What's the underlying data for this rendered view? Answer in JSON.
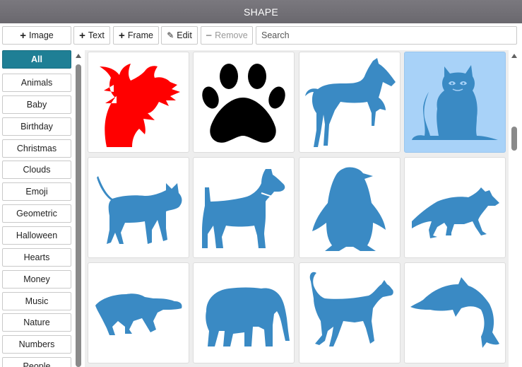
{
  "window": {
    "title": "SHAPE"
  },
  "toolbar": {
    "image": {
      "icon": "+",
      "label": "Image"
    },
    "text": {
      "icon": "+",
      "label": "Text"
    },
    "frame": {
      "icon": "+",
      "label": "Frame"
    },
    "edit": {
      "icon": "✎",
      "label": "Edit"
    },
    "remove": {
      "icon": "−",
      "label": "Remove"
    },
    "search": {
      "placeholder": "Search",
      "value": ""
    }
  },
  "sidebar": {
    "active": "All",
    "items": [
      {
        "label": "All"
      },
      {
        "label": "Animals"
      },
      {
        "label": "Baby"
      },
      {
        "label": "Birthday"
      },
      {
        "label": "Christmas"
      },
      {
        "label": "Clouds"
      },
      {
        "label": "Emoji"
      },
      {
        "label": "Geometric"
      },
      {
        "label": "Halloween"
      },
      {
        "label": "Hearts"
      },
      {
        "label": "Money"
      },
      {
        "label": "Music"
      },
      {
        "label": "Nature"
      },
      {
        "label": "Numbers"
      },
      {
        "label": "People"
      }
    ]
  },
  "grid": {
    "selected_index": 3,
    "shapes": [
      {
        "name": "dragon",
        "color": "#ff0000"
      },
      {
        "name": "paw",
        "color": "#000000"
      },
      {
        "name": "horse",
        "color": "#3a8ac4"
      },
      {
        "name": "cat-sitting",
        "color": "#3a8ac4"
      },
      {
        "name": "cat-walking",
        "color": "#3a8ac4"
      },
      {
        "name": "dog",
        "color": "#3a8ac4"
      },
      {
        "name": "penguin",
        "color": "#3a8ac4"
      },
      {
        "name": "fox",
        "color": "#3a8ac4"
      },
      {
        "name": "crocodile",
        "color": "#3a8ac4"
      },
      {
        "name": "elephant",
        "color": "#3a8ac4"
      },
      {
        "name": "greyhound",
        "color": "#3a8ac4"
      },
      {
        "name": "dolphin",
        "color": "#3a8ac4"
      }
    ]
  },
  "theme": {
    "accent": "#1f7f95",
    "selected_tile": "#a8d2f8",
    "shape_blue": "#3a8ac4"
  }
}
